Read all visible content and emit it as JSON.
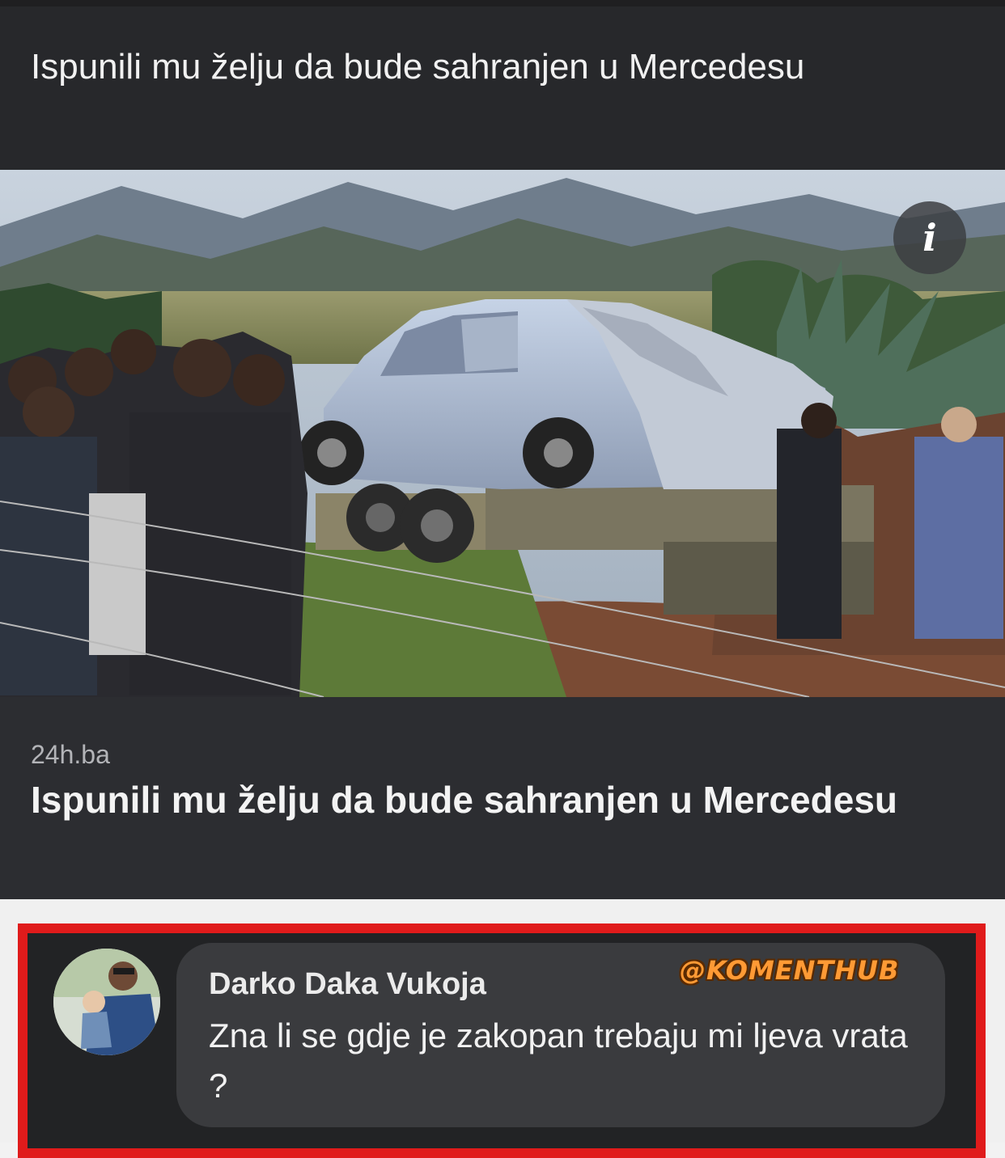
{
  "post": {
    "header_text": "Ispunili mu želju da bude sahranjen u Mercedesu"
  },
  "link_preview": {
    "domain": "24h.ba",
    "title": "Ispunili mu želju da bude sahranjen u Mercedesu",
    "info_glyph": "i"
  },
  "comment": {
    "author": "Darko Daka Vukoja",
    "text": "Zna li se gdje je zakopan trebaju mi ljeva vrata ?"
  },
  "watermark": {
    "text": "@KOMENTHUB"
  },
  "icons": {
    "info": "info-icon",
    "avatar": "avatar"
  },
  "colors": {
    "header_bg": "#27282b",
    "link_meta_bg": "#2c2d31",
    "comment_bubble_bg": "#3a3b3e",
    "highlight": "#e01b1b",
    "watermark": "#ff9a35"
  }
}
